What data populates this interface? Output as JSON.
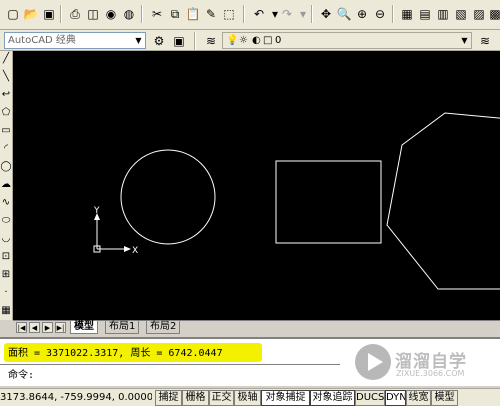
{
  "toolbar2": {
    "workspace": "AutoCAD 经典",
    "layer": "0"
  },
  "tabs": [
    "模型",
    "布局1",
    "布局2"
  ],
  "command": {
    "result": "面积 = 3371022.3317, 周长 = 6742.0447",
    "prompt": "命令:"
  },
  "status": {
    "coords": "3173.8644, -759.9994, 0.0000",
    "buttons": [
      "捕捉",
      "栅格",
      "正交",
      "极轴",
      "对象捕捉",
      "对象追踪",
      "DUCS",
      "DYN",
      "线宽",
      "模型"
    ]
  },
  "ucs": {
    "y": "Y",
    "x": "X"
  },
  "watermark": {
    "name": "溜溜自学",
    "url": "ZIXUE.3066.COM"
  },
  "colors": {
    "drawing_bg": "#000000",
    "highlight": "#f3f000"
  }
}
